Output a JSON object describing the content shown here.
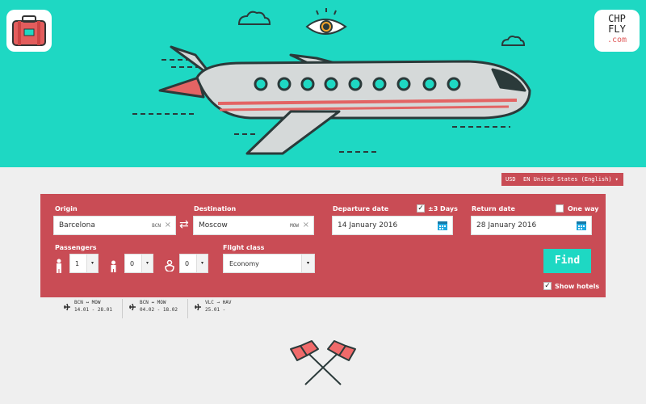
{
  "header": {
    "brand_logo": {
      "line1": "CHP",
      "line2": "FLY",
      "line3": ".com"
    },
    "colors": {
      "hero_bg": "#1ed8c3",
      "panel_bg": "#c94c55",
      "accent": "#1ed8c3"
    }
  },
  "locale": {
    "currency": "USD",
    "language": "EN United States (English)"
  },
  "search_form": {
    "origin": {
      "label": "Origin",
      "value": "Barcelona",
      "code": "BCN"
    },
    "destination": {
      "label": "Destination",
      "value": "Moscow",
      "code": "MOW"
    },
    "departure": {
      "label": "Departure date",
      "value": "14 January 2016",
      "flex_label": "±3 Days",
      "flex_checked": true
    },
    "return": {
      "label": "Return date",
      "value": "28 January 2016",
      "oneway_label": "One way",
      "oneway_checked": false
    },
    "passengers": {
      "label": "Passengers",
      "adults": "1",
      "children": "0",
      "infants": "0"
    },
    "flight_class": {
      "label": "Flight class",
      "value": "Economy"
    },
    "find_label": "Find",
    "show_hotels": {
      "label": "Show hotels",
      "checked": true
    }
  },
  "recent_searches": [
    {
      "route": "BCN ↔ MOW",
      "dates": "14.01 - 28.01"
    },
    {
      "route": "BCN ↔ MOW",
      "dates": "04.02 - 18.02"
    },
    {
      "route": "VLC → HAV",
      "dates": "25.01 -"
    }
  ],
  "icons": [
    "suitcase-icon",
    "eye-icon",
    "plane-icon",
    "swap-icon",
    "calendar-icon",
    "adult-icon",
    "child-icon",
    "infant-icon",
    "flags-icon"
  ]
}
